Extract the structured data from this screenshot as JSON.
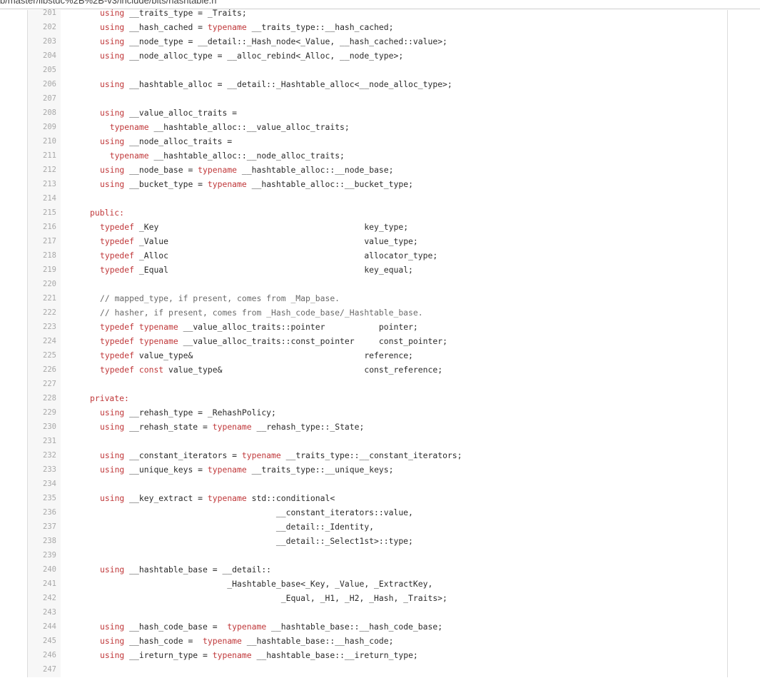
{
  "browser": {
    "url_fragment": "b/master/libstdc%2B%2B-v3/include/bits/hashtable.h"
  },
  "code": {
    "lines": [
      {
        "n": "201",
        "t": [
          [
            "k",
            "using"
          ],
          [
            "p",
            " __traits_type = _Traits;"
          ]
        ]
      },
      {
        "n": "202",
        "t": [
          [
            "k",
            "using"
          ],
          [
            "p",
            " __hash_cached = "
          ],
          [
            "k",
            "typename"
          ],
          [
            "p",
            " __traits_type::__hash_cached;"
          ]
        ]
      },
      {
        "n": "203",
        "t": [
          [
            "k",
            "using"
          ],
          [
            "p",
            " __node_type = __detail::_Hash_node<_Value, __hash_cached::value>;"
          ]
        ]
      },
      {
        "n": "204",
        "t": [
          [
            "k",
            "using"
          ],
          [
            "p",
            " __node_alloc_type = __alloc_rebind<_Alloc, __node_type>;"
          ]
        ]
      },
      {
        "n": "205",
        "t": []
      },
      {
        "n": "206",
        "t": [
          [
            "k",
            "using"
          ],
          [
            "p",
            " __hashtable_alloc = __detail::_Hashtable_alloc<__node_alloc_type>;"
          ]
        ]
      },
      {
        "n": "207",
        "t": []
      },
      {
        "n": "208",
        "t": [
          [
            "k",
            "using"
          ],
          [
            "p",
            " __value_alloc_traits ="
          ]
        ]
      },
      {
        "n": "209",
        "t": [
          [
            "p",
            "  "
          ],
          [
            "k",
            "typename"
          ],
          [
            "p",
            " __hashtable_alloc::__value_alloc_traits;"
          ]
        ]
      },
      {
        "n": "210",
        "t": [
          [
            "k",
            "using"
          ],
          [
            "p",
            " __node_alloc_traits ="
          ]
        ]
      },
      {
        "n": "211",
        "t": [
          [
            "p",
            "  "
          ],
          [
            "k",
            "typename"
          ],
          [
            "p",
            " __hashtable_alloc::__node_alloc_traits;"
          ]
        ]
      },
      {
        "n": "212",
        "t": [
          [
            "k",
            "using"
          ],
          [
            "p",
            " __node_base = "
          ],
          [
            "k",
            "typename"
          ],
          [
            "p",
            " __hashtable_alloc::__node_base;"
          ]
        ]
      },
      {
        "n": "213",
        "t": [
          [
            "k",
            "using"
          ],
          [
            "p",
            " __bucket_type = "
          ],
          [
            "k",
            "typename"
          ],
          [
            "p",
            " __hashtable_alloc::__bucket_type;"
          ]
        ]
      },
      {
        "n": "214",
        "t": []
      },
      {
        "n": "215",
        "t": [
          [
            "k",
            "public:"
          ]
        ],
        "o": -2
      },
      {
        "n": "216",
        "t": [
          [
            "k",
            "typedef"
          ],
          [
            "p",
            " _Key                                          key_type;"
          ]
        ]
      },
      {
        "n": "217",
        "t": [
          [
            "k",
            "typedef"
          ],
          [
            "p",
            " _Value                                        value_type;"
          ]
        ]
      },
      {
        "n": "218",
        "t": [
          [
            "k",
            "typedef"
          ],
          [
            "p",
            " _Alloc                                        allocator_type;"
          ]
        ]
      },
      {
        "n": "219",
        "t": [
          [
            "k",
            "typedef"
          ],
          [
            "p",
            " _Equal                                        key_equal;"
          ]
        ]
      },
      {
        "n": "220",
        "t": []
      },
      {
        "n": "221",
        "t": [
          [
            "c",
            "// mapped_type, if present, comes from _Map_base."
          ]
        ]
      },
      {
        "n": "222",
        "t": [
          [
            "c",
            "// hasher, if present, comes from _Hash_code_base/_Hashtable_base."
          ]
        ]
      },
      {
        "n": "223",
        "t": [
          [
            "k",
            "typedef"
          ],
          [
            "p",
            " "
          ],
          [
            "k",
            "typename"
          ],
          [
            "p",
            " __value_alloc_traits::pointer           pointer;"
          ]
        ]
      },
      {
        "n": "224",
        "t": [
          [
            "k",
            "typedef"
          ],
          [
            "p",
            " "
          ],
          [
            "k",
            "typename"
          ],
          [
            "p",
            " __value_alloc_traits::const_pointer     const_pointer;"
          ]
        ]
      },
      {
        "n": "225",
        "t": [
          [
            "k",
            "typedef"
          ],
          [
            "p",
            " value_type&                                   reference;"
          ]
        ]
      },
      {
        "n": "226",
        "t": [
          [
            "k",
            "typedef"
          ],
          [
            "p",
            " "
          ],
          [
            "k",
            "const"
          ],
          [
            "p",
            " value_type&                             const_reference;"
          ]
        ]
      },
      {
        "n": "227",
        "t": []
      },
      {
        "n": "228",
        "t": [
          [
            "k",
            "private:"
          ]
        ],
        "o": -2
      },
      {
        "n": "229",
        "t": [
          [
            "k",
            "using"
          ],
          [
            "p",
            " __rehash_type = _RehashPolicy;"
          ]
        ]
      },
      {
        "n": "230",
        "t": [
          [
            "k",
            "using"
          ],
          [
            "p",
            " __rehash_state = "
          ],
          [
            "k",
            "typename"
          ],
          [
            "p",
            " __rehash_type::_State;"
          ]
        ]
      },
      {
        "n": "231",
        "t": []
      },
      {
        "n": "232",
        "t": [
          [
            "k",
            "using"
          ],
          [
            "p",
            " __constant_iterators = "
          ],
          [
            "k",
            "typename"
          ],
          [
            "p",
            " __traits_type::__constant_iterators;"
          ]
        ]
      },
      {
        "n": "233",
        "t": [
          [
            "k",
            "using"
          ],
          [
            "p",
            " __unique_keys = "
          ],
          [
            "k",
            "typename"
          ],
          [
            "p",
            " __traits_type::__unique_keys;"
          ]
        ]
      },
      {
        "n": "234",
        "t": []
      },
      {
        "n": "235",
        "t": [
          [
            "k",
            "using"
          ],
          [
            "p",
            " __key_extract = "
          ],
          [
            "k",
            "typename"
          ],
          [
            "p",
            " std::conditional<"
          ]
        ]
      },
      {
        "n": "236",
        "t": [
          [
            "p",
            "                                    __constant_iterators::value,"
          ]
        ]
      },
      {
        "n": "237",
        "t": [
          [
            "p",
            "                                    __detail::_Identity,"
          ]
        ]
      },
      {
        "n": "238",
        "t": [
          [
            "p",
            "                                    __detail::_Select1st>::type;"
          ]
        ]
      },
      {
        "n": "239",
        "t": []
      },
      {
        "n": "240",
        "t": [
          [
            "k",
            "using"
          ],
          [
            "p",
            " __hashtable_base = __detail::"
          ]
        ]
      },
      {
        "n": "241",
        "t": [
          [
            "p",
            "                          _Hashtable_base<_Key, _Value, _ExtractKey,"
          ]
        ]
      },
      {
        "n": "242",
        "t": [
          [
            "p",
            "                                     _Equal, _H1, _H2, _Hash, _Traits>;"
          ]
        ]
      },
      {
        "n": "243",
        "t": []
      },
      {
        "n": "244",
        "t": [
          [
            "k",
            "using"
          ],
          [
            "p",
            " __hash_code_base =  "
          ],
          [
            "k",
            "typename"
          ],
          [
            "p",
            " __hashtable_base::__hash_code_base;"
          ]
        ]
      },
      {
        "n": "245",
        "t": [
          [
            "k",
            "using"
          ],
          [
            "p",
            " __hash_code =  "
          ],
          [
            "k",
            "typename"
          ],
          [
            "p",
            " __hashtable_base::__hash_code;"
          ]
        ]
      },
      {
        "n": "246",
        "t": [
          [
            "k",
            "using"
          ],
          [
            "p",
            " __ireturn_type = "
          ],
          [
            "k",
            "typename"
          ],
          [
            "p",
            " __hashtable_base::__ireturn_type;"
          ]
        ]
      },
      {
        "n": "247",
        "t": []
      }
    ]
  },
  "colors": {
    "keyword": "#c0383a",
    "text": "#2b2b2b",
    "comment": "#6b6b6b",
    "line_number": "#a8a8a8"
  }
}
